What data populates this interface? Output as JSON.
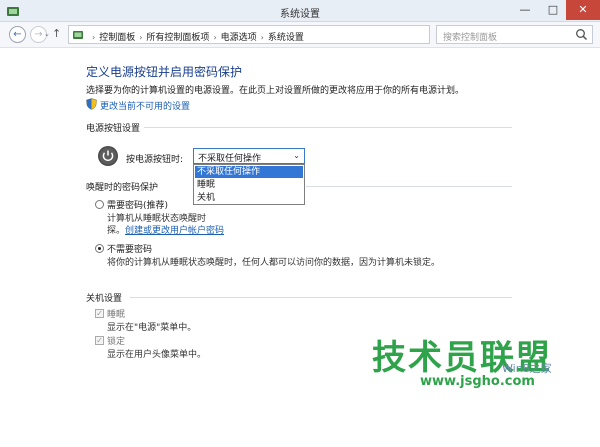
{
  "window": {
    "title": "系统设置",
    "minimize": "—",
    "maximize": "□",
    "close": "✕"
  },
  "nav": {
    "back": "←",
    "forward": "→",
    "up": "↑",
    "history": "⌄",
    "breadcrumb": [
      "控制面板",
      "所有控制面板项",
      "电源选项",
      "系统设置"
    ],
    "breadcrumb_sep": "›",
    "address_dropdown": "⌄",
    "refresh": "↻",
    "search_placeholder": "搜索控制面板"
  },
  "page": {
    "title": "定义电源按钮并启用密码保护",
    "description": "选择要为你的计算机设置的电源设置。在此页上对设置所做的更改将应用于你的所有电源计划。",
    "change_link": "更改当前不可用的设置"
  },
  "power_buttons": {
    "section": "电源按钮设置",
    "label": "按电源按钮时:",
    "selected": "不采取任何操作",
    "arrow": "⌄",
    "options": [
      "不采取任何操作",
      "睡眠",
      "关机"
    ],
    "selected_index": 0
  },
  "wake_password": {
    "section": "唤醒时的密码保护",
    "require": {
      "title": "需要密码(推荐)",
      "desc_line1": "计算机从睡眠状态唤醒时",
      "desc_line2": "探。",
      "link": "创建或更改用户帐户密码",
      "checked": false
    },
    "no_require": {
      "title": "不需要密码",
      "desc": "将你的计算机从睡眠状态唤醒时，任何人都可以访问你的数据，因为计算机未锁定。",
      "checked": true
    }
  },
  "shutdown": {
    "section": "关机设置",
    "items": [
      {
        "label": "睡眠",
        "desc": "显示在\"电源\"菜单中。",
        "checked": true
      },
      {
        "label": "锁定",
        "desc": "显示在用户头像菜单中。",
        "checked": true
      }
    ],
    "check_mark": "✓"
  },
  "watermark": {
    "brand": "技术员联盟",
    "site": "www.jsgho.com",
    "win": "Win8之家"
  },
  "colors": {
    "link": "#1a5fb4",
    "title": "#1a3f8f",
    "selection": "#3377d6",
    "watermark": "#2fa34a"
  }
}
